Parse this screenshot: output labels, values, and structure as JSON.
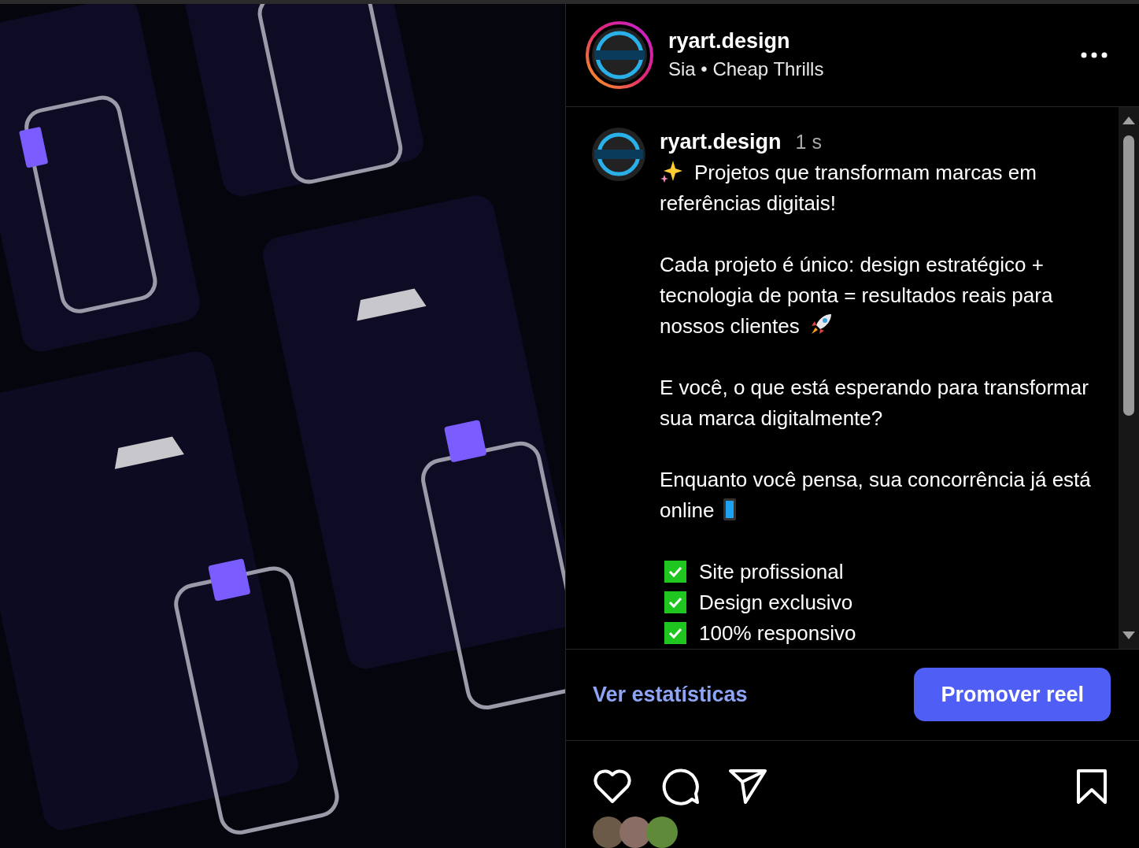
{
  "post_header": {
    "username": "ryart.design",
    "audio": "Sia • Cheap Thrills"
  },
  "caption": {
    "username": "ryart.design",
    "time": "1 s",
    "paragraphs": [
      {
        "kind": "sparkle_lead",
        "text": "Projetos que transformam marcas em referências digitais!"
      },
      {
        "kind": "rocket_end",
        "text": "Cada projeto é único: design estratégico + tecnologia de ponta = resultados reais para nossos clientes"
      },
      {
        "kind": "plain",
        "text": "E você, o que está esperando para transformar sua marca digitalmente?"
      },
      {
        "kind": "phone_end",
        "text": "Enquanto você pensa, sua concorrência já está online"
      }
    ],
    "checklist": [
      {
        "text": "Site profissional",
        "checked": true
      },
      {
        "text": "Design exclusivo",
        "checked": true
      },
      {
        "text": "100% responsivo",
        "checked": true
      }
    ]
  },
  "actions": {
    "link": "Ver estatísticas",
    "button": "Promover reel"
  },
  "bookmark": {
    "saved": false
  },
  "like": {
    "liked": false
  }
}
